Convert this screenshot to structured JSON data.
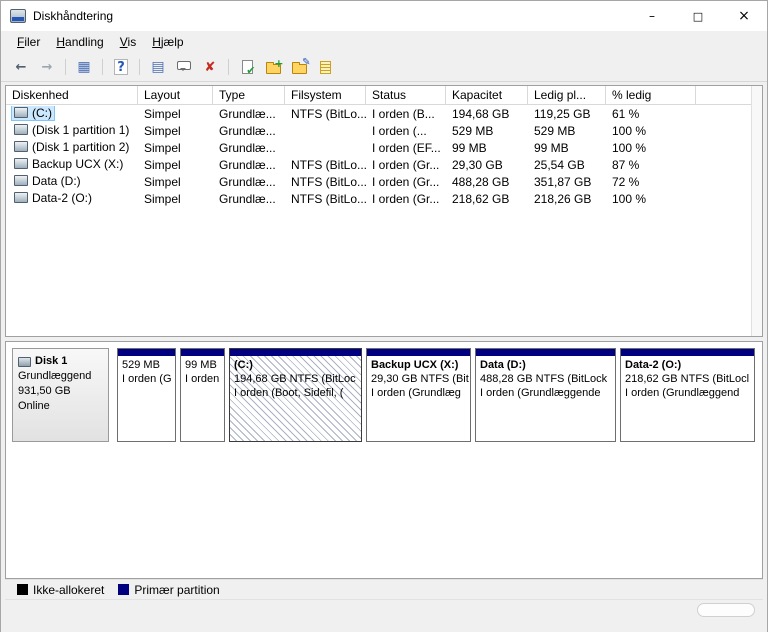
{
  "window": {
    "title": "Diskhåndtering",
    "minimize": "–",
    "maximize": "□",
    "close": "×"
  },
  "menu": {
    "items": [
      "Filer",
      "Handling",
      "Vis",
      "Hjælp"
    ]
  },
  "toolbar": {
    "icons": {
      "back": "←",
      "forward": "→",
      "console_tree": "▦",
      "help": "?",
      "list_view": "▤",
      "delete": "✘",
      "check": "✔"
    }
  },
  "volume_table": {
    "columns": [
      "Diskenhed",
      "Layout",
      "Type",
      "Filsystem",
      "Status",
      "Kapacitet",
      "Ledig pl...",
      "% ledig"
    ],
    "rows": [
      {
        "volume": "(C:)",
        "layout": "Simpel",
        "type": "Grundlæ...",
        "filesystem": "NTFS (BitLo...",
        "status": "I orden (B...",
        "capacity": "194,68 GB",
        "free": "119,25 GB",
        "pct": "61 %"
      },
      {
        "volume": "(Disk 1 partition 1)",
        "layout": "Simpel",
        "type": "Grundlæ...",
        "filesystem": "",
        "status": "I orden (...",
        "capacity": "529 MB",
        "free": "529 MB",
        "pct": "100 %"
      },
      {
        "volume": "(Disk 1 partition 2)",
        "layout": "Simpel",
        "type": "Grundlæ...",
        "filesystem": "",
        "status": "I orden (EF...",
        "capacity": "99 MB",
        "free": "99 MB",
        "pct": "100 %"
      },
      {
        "volume": "Backup UCX (X:)",
        "layout": "Simpel",
        "type": "Grundlæ...",
        "filesystem": "NTFS (BitLo...",
        "status": "I orden (Gr...",
        "capacity": "29,30 GB",
        "free": "25,54 GB",
        "pct": "87 %"
      },
      {
        "volume": "Data (D:)",
        "layout": "Simpel",
        "type": "Grundlæ...",
        "filesystem": "NTFS (BitLo...",
        "status": "I orden (Gr...",
        "capacity": "488,28 GB",
        "free": "351,87 GB",
        "pct": "72 %"
      },
      {
        "volume": "Data-2 (O:)",
        "layout": "Simpel",
        "type": "Grundlæ...",
        "filesystem": "NTFS (BitLo...",
        "status": "I orden (Gr...",
        "capacity": "218,62 GB",
        "free": "218,26 GB",
        "pct": "100 %"
      }
    ]
  },
  "disk": {
    "name": "Disk 1",
    "type": "Grundlæggend",
    "size": "931,50 GB",
    "status": "Online"
  },
  "partitions": [
    {
      "name": "",
      "size_line": "529 MB",
      "status_line": "I orden (G"
    },
    {
      "name": "",
      "size_line": "99 MB",
      "status_line": "I orden"
    },
    {
      "name": "(C:)",
      "size_line": "194,68 GB NTFS (BitLoc",
      "status_line": "I orden (Boot, Sidefil, ("
    },
    {
      "name": "Backup UCX  (X:)",
      "size_line": "29,30 GB NTFS (Bit",
      "status_line": "I orden (Grundlæg"
    },
    {
      "name": "Data  (D:)",
      "size_line": "488,28 GB NTFS (BitLock",
      "status_line": "I orden (Grundlæggende"
    },
    {
      "name": "Data-2  (O:)",
      "size_line": "218,62 GB NTFS (BitLocl",
      "status_line": "I orden (Grundlæggend"
    }
  ],
  "legend": {
    "items": [
      {
        "label": "Ikke-allokeret",
        "color": "#000000"
      },
      {
        "label": "Primær partition",
        "color": "#000080"
      }
    ]
  },
  "colors": {
    "partition_bar": "#000080",
    "selection": "#cce8ff"
  }
}
